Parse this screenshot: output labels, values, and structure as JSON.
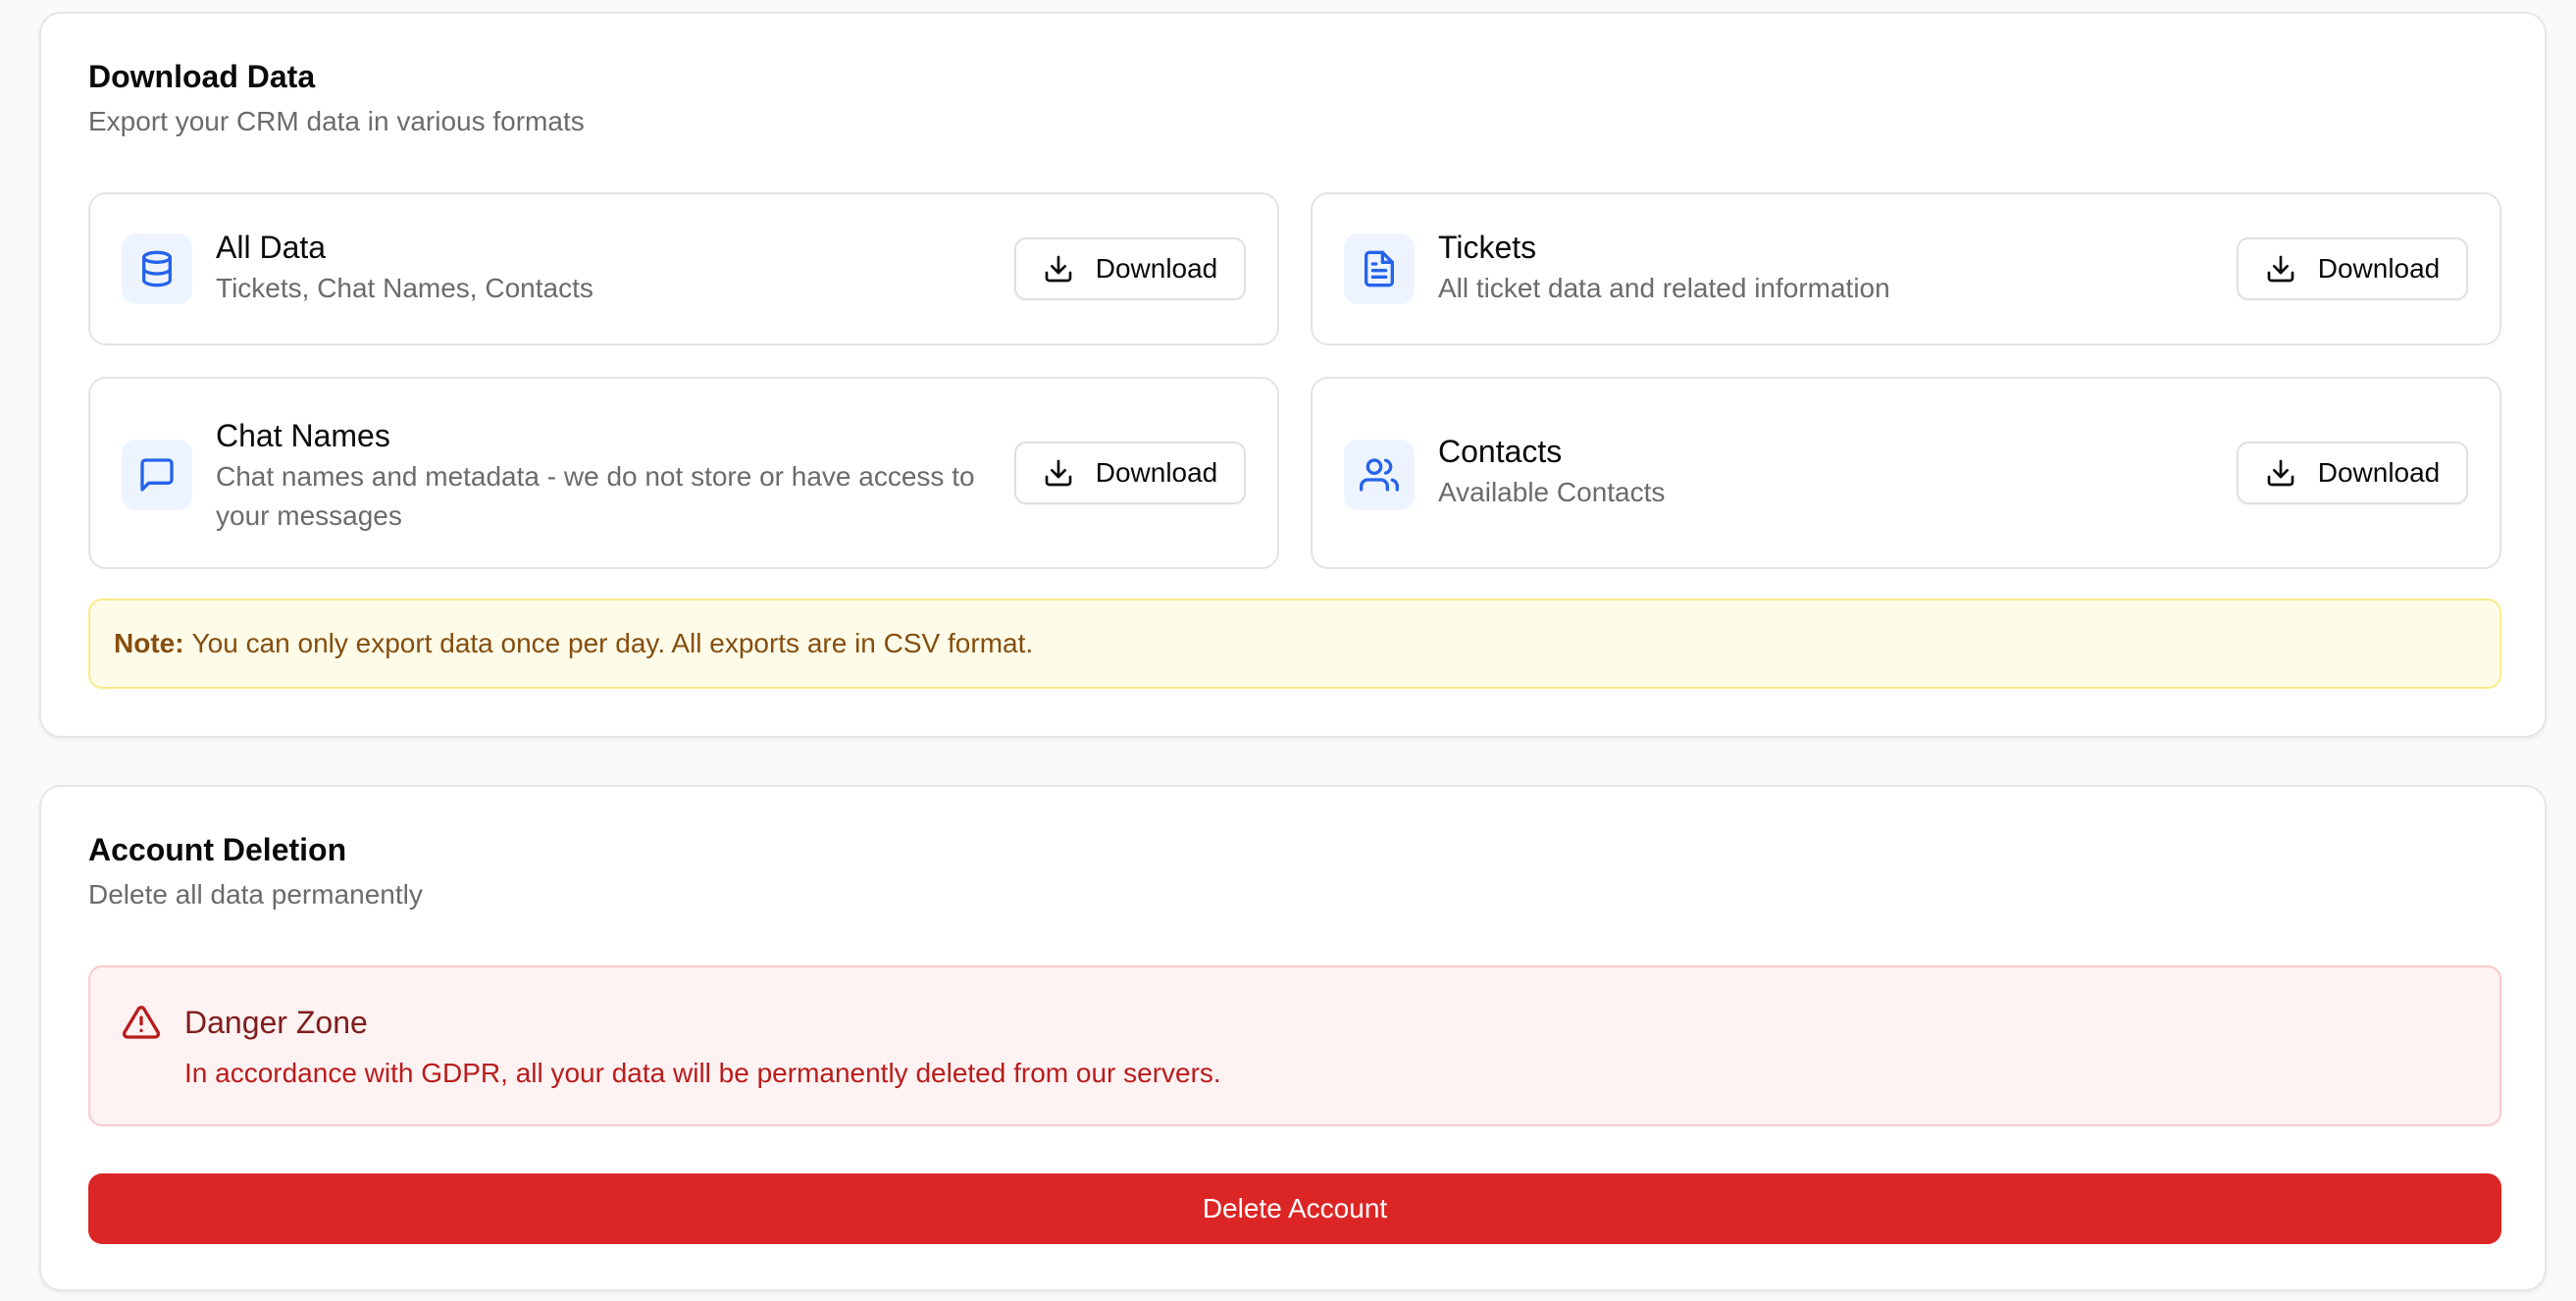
{
  "download_section": {
    "title": "Download Data",
    "subtitle": "Export your CRM data in various formats",
    "items": [
      {
        "title": "All Data",
        "description": "Tickets, Chat Names, Contacts",
        "icon": "database-icon",
        "button_label": "Download"
      },
      {
        "title": "Tickets",
        "description": "All ticket data and related information",
        "icon": "file-text-icon",
        "button_label": "Download"
      },
      {
        "title": "Chat Names",
        "description": "Chat names and metadata - we do not store or have access to your messages",
        "icon": "message-square-icon",
        "button_label": "Download"
      },
      {
        "title": "Contacts",
        "description": "Available Contacts",
        "icon": "users-icon",
        "button_label": "Download"
      }
    ],
    "note_label": "Note:",
    "note_text": "You can only export data once per day. All exports are in CSV format."
  },
  "deletion_section": {
    "title": "Account Deletion",
    "subtitle": "Delete all data permanently",
    "danger_title": "Danger Zone",
    "danger_text": "In accordance with GDPR, all your data will be permanently deleted from our servers.",
    "delete_button_label": "Delete Account"
  },
  "colors": {
    "icon_accent": "#2563eb",
    "danger": "#dc2626",
    "note_text": "#854d0e"
  }
}
